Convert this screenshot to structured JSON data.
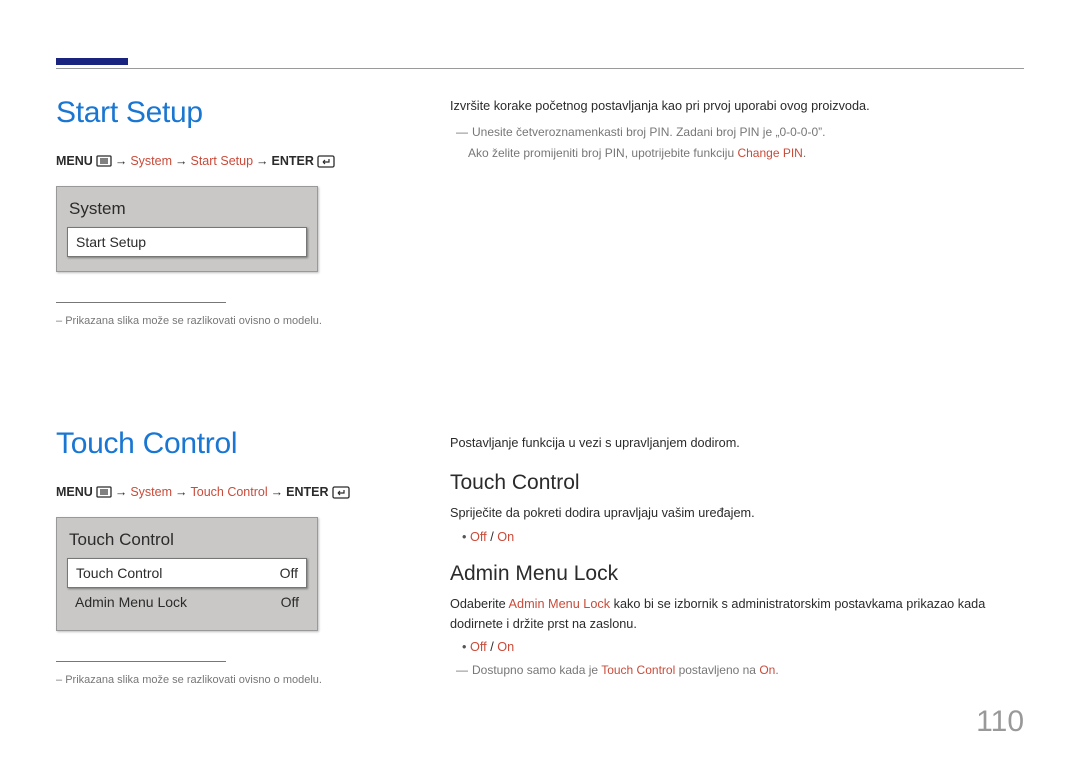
{
  "top": {},
  "section1": {
    "title": "Start Setup",
    "breadcrumb": {
      "menu": "MENU",
      "system": "System",
      "item": "Start Setup",
      "enter": "ENTER"
    },
    "panel": {
      "title": "System",
      "row": "Start Setup"
    },
    "disclaimer": "Prikazana slika može se razlikovati ovisno o modelu."
  },
  "section2": {
    "title": "Touch Control",
    "breadcrumb": {
      "menu": "MENU",
      "system": "System",
      "item": "Touch Control",
      "enter": "ENTER"
    },
    "panel": {
      "title": "Touch Control",
      "rows": [
        {
          "label": "Touch Control",
          "value": "Off"
        },
        {
          "label": "Admin Menu Lock",
          "value": "Off"
        }
      ]
    },
    "disclaimer": "Prikazana slika može se razlikovati ovisno o modelu."
  },
  "right": {
    "s1_body": "Izvršite korake početnog postavljanja kao pri prvoj uporabi ovog proizvoda.",
    "s1_note_a": "Unesite četveroznamenkasti broj PIN. Zadani broj PIN je „0-0-0-0”.",
    "s1_note_b_1": "Ako želite promijeniti broj PIN, upotrijebite funkciju ",
    "s1_note_b_link": "Change PIN",
    "s1_note_b_2": ".",
    "s2_intro": "Postavljanje funkcija u vezi s upravljanjem dodirom.",
    "tc": {
      "heading": "Touch Control",
      "desc": "Spriječite da pokreti dodira upravljaju vašim uređajem.",
      "off": "Off",
      "sep": " / ",
      "on": "On"
    },
    "aml": {
      "heading": "Admin Menu Lock",
      "desc_1": "Odaberite ",
      "desc_link": "Admin Menu Lock",
      "desc_2": " kako bi se izbornik s administratorskim postavkama prikazao kada dodirnete i držite prst na zaslonu.",
      "off": "Off",
      "sep": " / ",
      "on": "On",
      "note_1": "Dostupno samo kada je ",
      "note_link1": "Touch Control",
      "note_2": " postavljeno na ",
      "note_link2": "On",
      "note_3": "."
    }
  },
  "page": "110"
}
